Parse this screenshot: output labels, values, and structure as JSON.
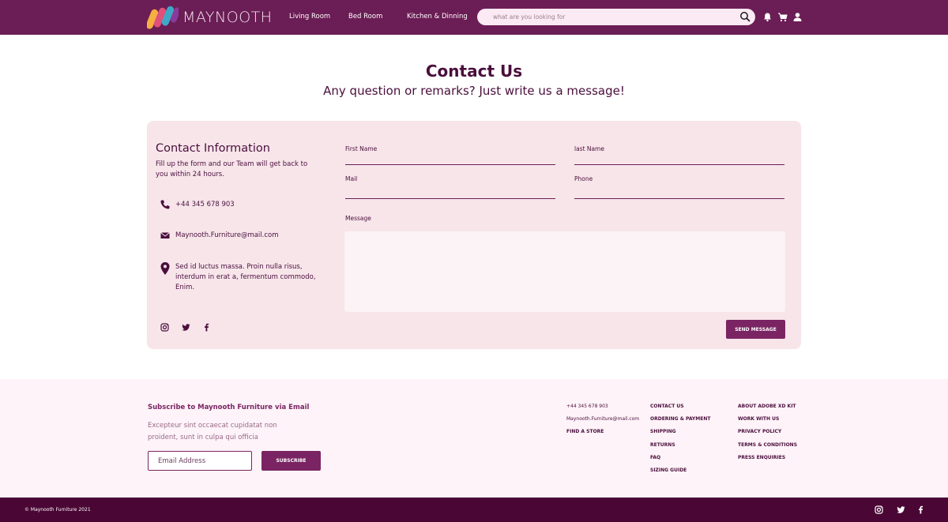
{
  "header": {
    "brand": "MAYNOOTH",
    "nav": [
      "Living Room",
      "Bed Room",
      "Kitchen & Dinning"
    ],
    "search_placeholder": "what are you looking for",
    "icons": [
      "search-icon",
      "bell-icon",
      "cart-icon",
      "user-icon"
    ]
  },
  "hero": {
    "title": "Contact Us",
    "subtitle": "Any question or remarks? Just write us a message!"
  },
  "contact_info": {
    "title": "Contact Information",
    "description": "Fill up the form and our Team will get back to you within 24 hours.",
    "phone": "+44 345 678 903",
    "email": "Maynooth.Furniture@mail.com",
    "address": "Sed id luctus massa. Proin nulla risus, interdum in erat a, fermentum commodo, Enim.",
    "social": [
      "instagram-icon",
      "twitter-icon",
      "facebook-icon"
    ]
  },
  "form": {
    "first_name_label": "First Name",
    "last_name_label": "last Name",
    "mail_label": "Mail",
    "phone_label": "Phone",
    "message_label": "Message",
    "send_label": "SEND MESSAGE"
  },
  "footer": {
    "subscribe_title": "Subscribe to Maynooth Furniture via Email",
    "subscribe_desc": "Excepteur sint occaecat cupidatat non proident, sunt in culpa qui officia",
    "email_placeholder": "Email Address",
    "subscribe_label": "SUBSCRIBE",
    "col1": [
      "+44 345 678 903",
      "Maynooth.Furniture@mail.com",
      "FIND A STORE"
    ],
    "col2": [
      "CONTACT US",
      "ORDERING & PAYMENT",
      "SHIPPING",
      "RETURNS",
      "FAQ",
      "SIZING GUIDE"
    ],
    "col3": [
      "ABOUT ADOBE XD KIT",
      "WORK WITH US",
      "PRIVACY POLICY",
      "TERMS & CONDITIONS",
      "PRESS ENQUIRIES"
    ]
  },
  "bottom": {
    "copyright": "© Maynooth Furniture 2021",
    "social": [
      "instagram-icon",
      "twitter-icon",
      "facebook-icon"
    ]
  },
  "colors": {
    "header_bg": "#6b1d55",
    "accent": "#7a2463",
    "card_bg": "#f7e5ea",
    "footer_bg": "#fdf3f8",
    "bottom_bg": "#4a0634"
  }
}
